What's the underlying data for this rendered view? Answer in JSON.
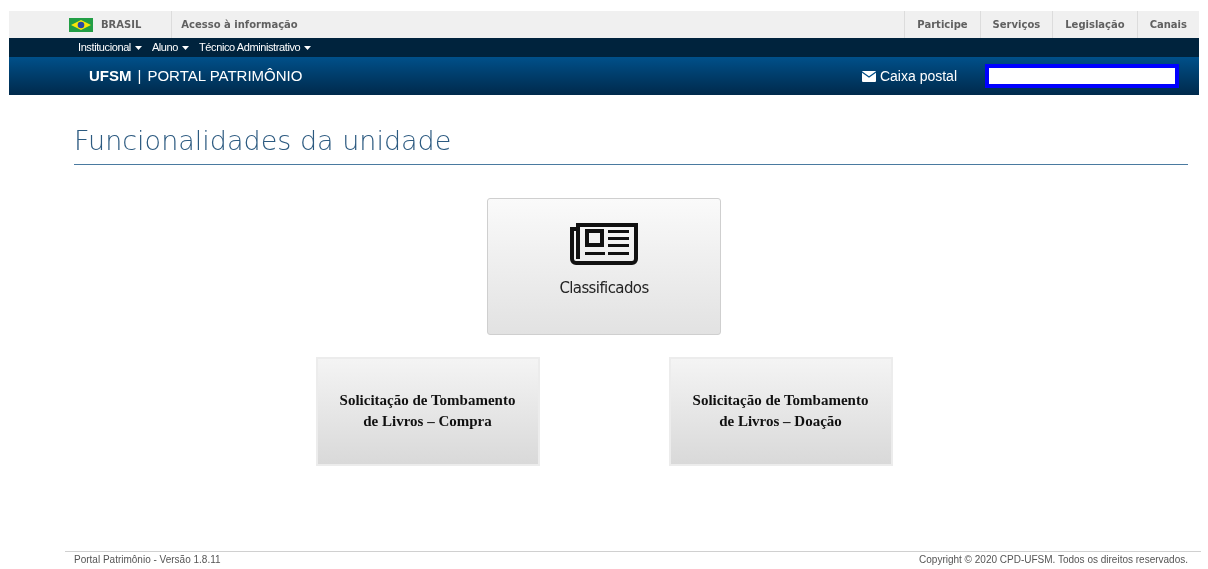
{
  "gov_bar": {
    "country": "BRASIL",
    "link": "Acesso à informação",
    "links": [
      "Participe",
      "Serviços",
      "Legislação",
      "Canais"
    ]
  },
  "menu": [
    "Institucional",
    "Aluno",
    "Técnico Administrativo"
  ],
  "header": {
    "brand": "UFSM",
    "separator": "|",
    "portal": "PORTAL PATRIMÔNIO",
    "mail_link": "Caixa postal"
  },
  "page_title": "Funcionalidades da unidade",
  "tiles": [
    {
      "kind": "icon",
      "label": "Classificados"
    },
    {
      "kind": "text",
      "label": "Solicitação de Tombamento de Livros – Compra"
    },
    {
      "kind": "text",
      "label": "Solicitação de Tombamento de Livros – Doação"
    }
  ],
  "footer": {
    "version": "Portal Patrimônio - Versão 1.8.11",
    "copyright": "Copyright © 2020 CPD-UFSM. Todos os direitos reservados."
  }
}
